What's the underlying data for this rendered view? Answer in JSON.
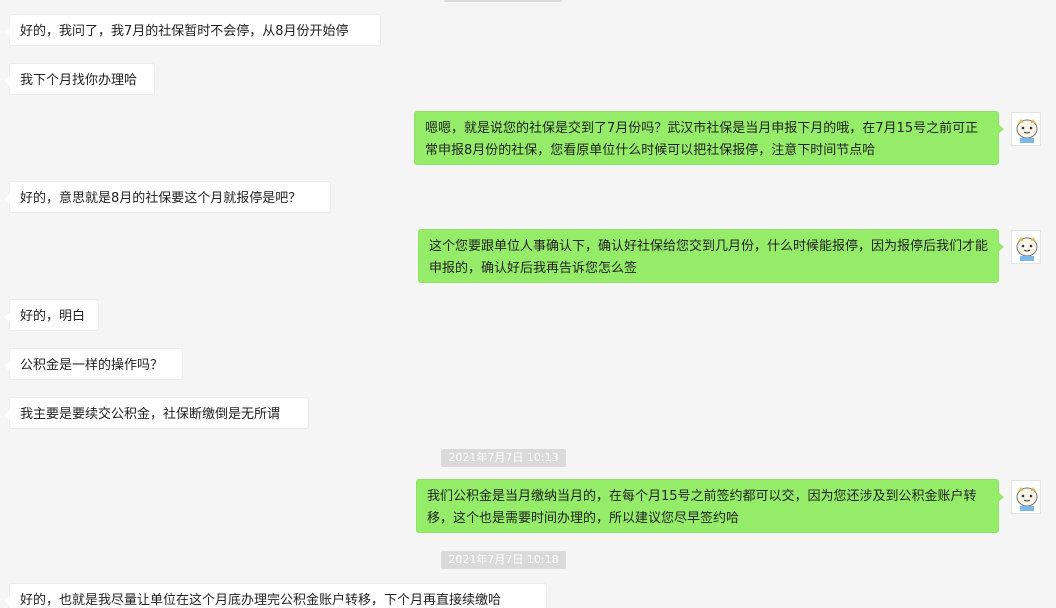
{
  "messages": {
    "m1": "好的，我问了，我7月的社保暂时不会停，从8月份开始停",
    "m2": "我下个月找你办理哈",
    "m3": "嗯嗯，就是说您的社保是交到了7月份吗？武汉市社保是当月申报下月的哦，在7月15号之前可正常申报8月份的社保，您看原单位什么时候可以把社保报停，注意下时间节点哈",
    "m4": "好的，意思就是8月的社保要这个月就报停是吧？",
    "m5": "这个您要跟单位人事确认下，确认好社保给您交到几月份，什么时候能报停，因为报停后我们才能申报的，确认好后我再告诉您怎么签",
    "m6": "好的，明白",
    "m7": "公积金是一样的操作吗？",
    "m8": "我主要是要续交公积金，社保断缴倒是无所谓",
    "m9": "我们公积金是当月缴纳当月的，在每个月15号之前签约都可以交，因为您还涉及到公积金账户转移，这个也是需要时间办理的，所以建议您尽早签约哈",
    "m10": "好的，也就是我尽量让单位在这个月底办理完公积金账户转移，下个月再直接续缴哈"
  },
  "timestamps": {
    "t1": "2021年7月7日 10:13",
    "t2": "2021年7月7日 10:18"
  },
  "colors": {
    "background": "#f5f5f5",
    "bubble_self": "#95ec69",
    "bubble_other": "#ffffff",
    "timestamp_bg": "#dadada"
  },
  "icons": {
    "self_avatar": "cartoon-avatar-icon"
  }
}
